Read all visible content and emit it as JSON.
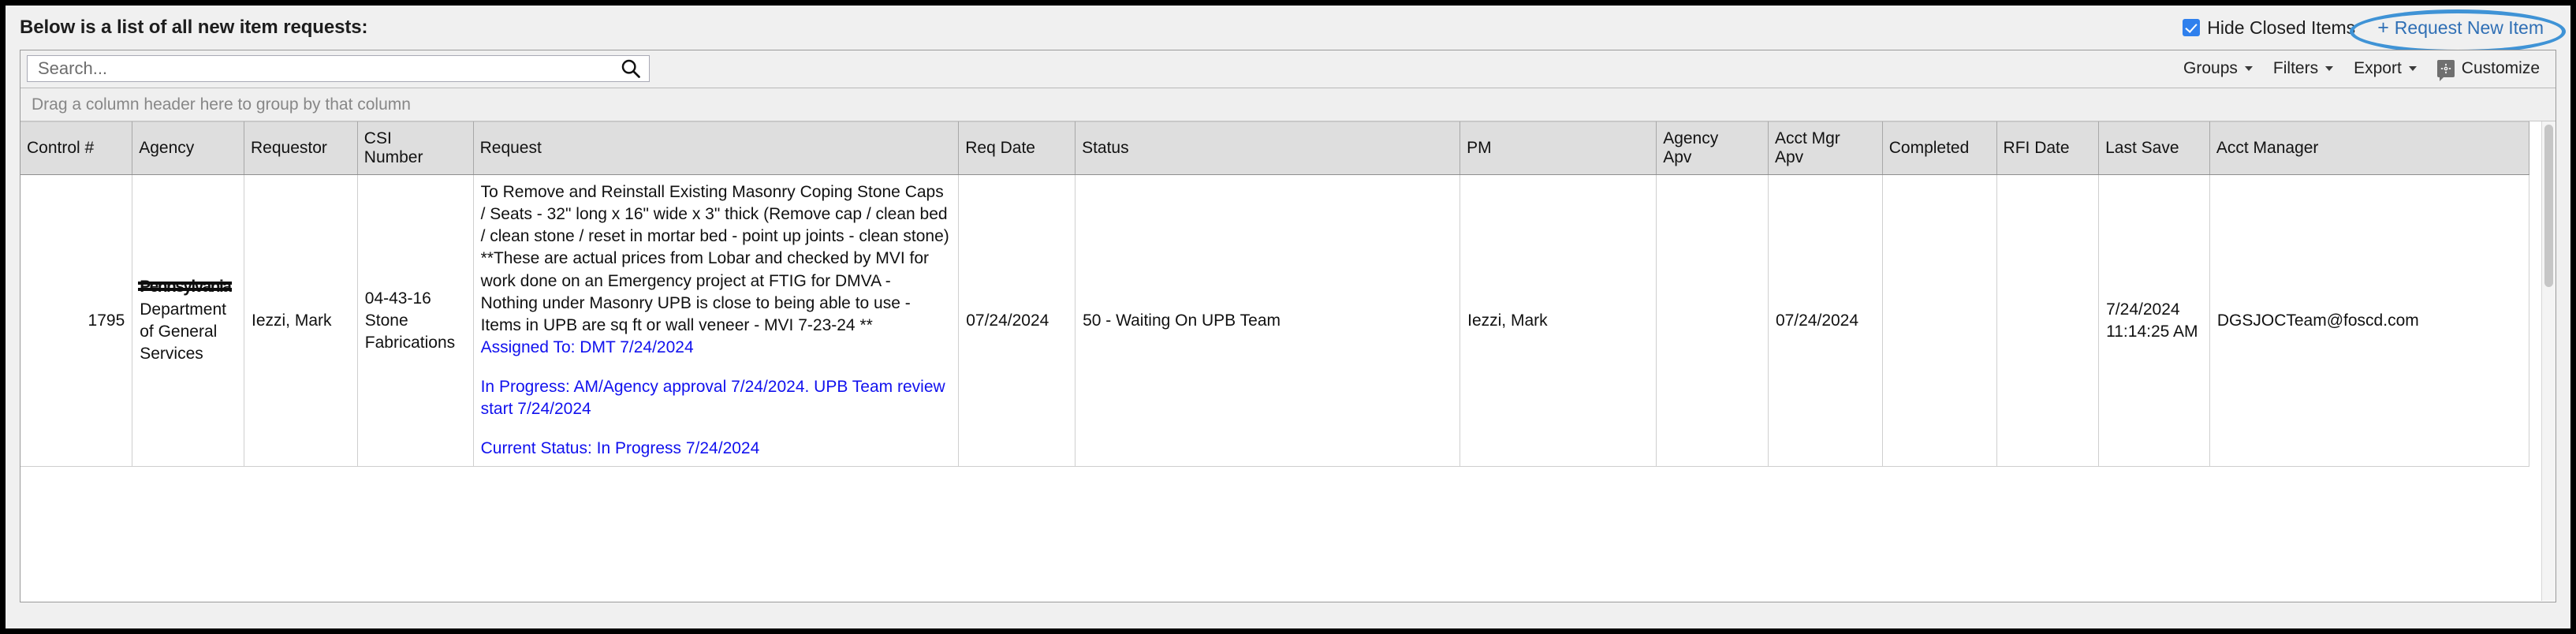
{
  "header": {
    "title": "Below is a list of all new item requests:",
    "hide_closed_label": "Hide Closed Items",
    "hide_closed_checked": true,
    "request_new_plus": "+",
    "request_new_label": "Request New Item",
    "annotation_color": "#3f93d6",
    "link_color": "#2f6fb5"
  },
  "toolbar": {
    "search_placeholder": "Search...",
    "search_value": "",
    "search_icon": "search-icon",
    "groups_label": "Groups",
    "filters_label": "Filters",
    "export_label": "Export",
    "customize_label": "Customize",
    "customize_icon": "gear-icon",
    "caret_icon": "chevron-down-icon"
  },
  "group_bar": {
    "hint": "Drag a column header here to group by that column"
  },
  "table": {
    "columns": [
      "Control #",
      "Agency",
      "Requestor",
      "CSI Number",
      "Request",
      "Req Date",
      "Status",
      "PM",
      "Agency Apv",
      "Acct Mgr Apv",
      "Completed",
      "RFI Date",
      "Last Save",
      "Acct Manager"
    ],
    "column_lines": [
      [
        "Control #"
      ],
      [
        "Agency"
      ],
      [
        "Requestor"
      ],
      [
        "CSI",
        "Number"
      ],
      [
        "Request"
      ],
      [
        "Req Date"
      ],
      [
        "Status"
      ],
      [
        "PM"
      ],
      [
        "Agency",
        "Apv"
      ],
      [
        "Acct Mgr",
        "Apv"
      ],
      [
        "Completed"
      ],
      [
        "RFI Date"
      ],
      [
        "Last Save"
      ],
      [
        "Acct Manager"
      ]
    ],
    "rows": [
      {
        "control_number": "1795",
        "agency_redacted": "Pennsylvania",
        "agency": "Department of General Services",
        "requestor": "Iezzi, Mark",
        "csi_number": "04-43-16 Stone Fabrications",
        "request_body": "To Remove and Reinstall Existing Masonry Coping Stone Caps / Seats - 32\" long x 16\" wide x 3\" thick (Remove cap / clean bed / clean stone / reset in mortar bed - point up joints - clean stone) **These are actual prices from Lobar and checked by MVI for work done on an Emergency project at FTIG for DMVA - Nothing under Masonry UPB is close to being able to use - Items in UPB are sq ft or wall veneer - MVI 7-23-24 **",
        "request_assigned": "Assigned To: DMT 7/24/2024",
        "request_in_progress": "In Progress: AM/Agency approval 7/24/2024. UPB Team review start 7/24/2024",
        "request_current_status": "Current Status: In Progress 7/24/2024",
        "req_date": "07/24/2024",
        "status": "50 - Waiting On UPB Team",
        "pm": "Iezzi, Mark",
        "agency_apv": "",
        "acct_mgr_apv": "07/24/2024",
        "completed": "",
        "rfi_date": "",
        "last_save": "7/24/2024 11:14:25 AM",
        "acct_manager": "DGSJOCTeam@foscd.com"
      }
    ]
  }
}
